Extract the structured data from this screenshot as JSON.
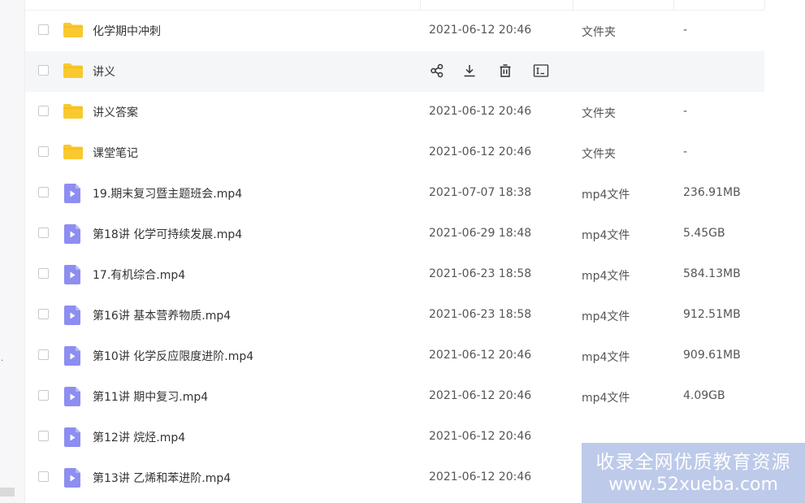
{
  "files": [
    {
      "name": "化学期中冲刺",
      "date": "2021-06-12 20:46",
      "type": "文件夹",
      "size": "-",
      "kind": "folder",
      "hover": false
    },
    {
      "name": "讲义",
      "date": "",
      "type": "",
      "size": "",
      "kind": "folder",
      "hover": true
    },
    {
      "name": "讲义答案",
      "date": "2021-06-12 20:46",
      "type": "文件夹",
      "size": "-",
      "kind": "folder",
      "hover": false
    },
    {
      "name": "课堂笔记",
      "date": "2021-06-12 20:46",
      "type": "文件夹",
      "size": "-",
      "kind": "folder",
      "hover": false
    },
    {
      "name": "19.期末复习暨主题班会.mp4",
      "date": "2021-07-07 18:38",
      "type": "mp4文件",
      "size": "236.91MB",
      "kind": "video",
      "hover": false
    },
    {
      "name": "第18讲 化学可持续发展.mp4",
      "date": "2021-06-29 18:48",
      "type": "mp4文件",
      "size": "5.45GB",
      "kind": "video",
      "hover": false
    },
    {
      "name": "17.有机综合.mp4",
      "date": "2021-06-23 18:58",
      "type": "mp4文件",
      "size": "584.13MB",
      "kind": "video",
      "hover": false
    },
    {
      "name": "第16讲 基本营养物质.mp4",
      "date": "2021-06-23 18:58",
      "type": "mp4文件",
      "size": "912.51MB",
      "kind": "video",
      "hover": false
    },
    {
      "name": "第10讲 化学反应限度进阶.mp4",
      "date": "2021-06-12 20:46",
      "type": "mp4文件",
      "size": "909.61MB",
      "kind": "video",
      "hover": false
    },
    {
      "name": "第11讲 期中复习.mp4",
      "date": "2021-06-12 20:46",
      "type": "mp4文件",
      "size": "4.09GB",
      "kind": "video",
      "hover": false
    },
    {
      "name": "第12讲 烷烃.mp4",
      "date": "2021-06-12 20:46",
      "type": "",
      "size": "",
      "kind": "video",
      "hover": false
    },
    {
      "name": "第13讲 乙烯和苯进阶.mp4",
      "date": "2021-06-12 20:46",
      "type": "",
      "size": "",
      "kind": "video",
      "hover": false
    }
  ],
  "hover_actions": [
    {
      "icon": "share-icon"
    },
    {
      "icon": "download-icon"
    },
    {
      "icon": "delete-icon"
    },
    {
      "icon": "rename-icon"
    }
  ],
  "watermark": {
    "line1": "收录全网优质教育资源",
    "line2": "www.52xueba.com"
  },
  "colors": {
    "folder": "#f9c92f",
    "video": "#8d8ef1",
    "hover_row": "#f5f6f8"
  }
}
